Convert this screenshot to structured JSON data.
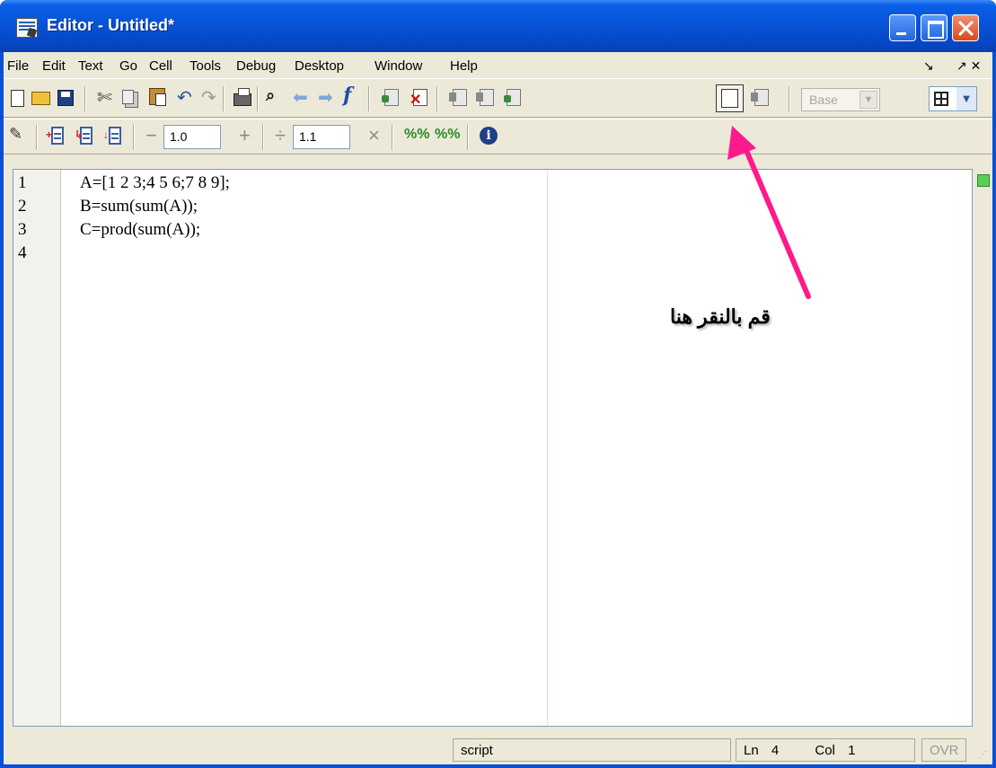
{
  "window": {
    "title": "Editor - Untitled*"
  },
  "menu": {
    "items": [
      "File",
      "Edit",
      "Text",
      "Go",
      "Cell",
      "Tools",
      "Debug",
      "Desktop",
      "Window",
      "Help"
    ],
    "right": [
      "↘",
      "↗ ✕"
    ]
  },
  "toolbar": {
    "icons": [
      "new-file",
      "open",
      "save",
      "cut",
      "copy",
      "paste",
      "undo",
      "redo",
      "print",
      "find",
      "back",
      "forward",
      "function",
      "set-breakpoint",
      "clear-breakpoints",
      "step",
      "step-in",
      "step-out",
      "continue",
      "exit-debug"
    ],
    "stack_select": "Base"
  },
  "cell_toolbar": {
    "decrement_value": "1.0",
    "increment_value": "1.1",
    "minus": "−",
    "plus": "+",
    "divide": "÷",
    "times": "×"
  },
  "editor": {
    "line_numbers": [
      "1",
      "2",
      "3",
      "4"
    ],
    "code": [
      "A=[1 2 3;4 5 6;7 8 9];",
      "B=sum(sum(A));",
      "C=prod(sum(A));",
      ""
    ]
  },
  "annotation": {
    "text": "قم بالنقر هنا"
  },
  "status": {
    "mode": "script",
    "ln_label": "Ln",
    "ln_value": "4",
    "col_label": "Col",
    "col_value": "1",
    "ovr": "OVR"
  }
}
